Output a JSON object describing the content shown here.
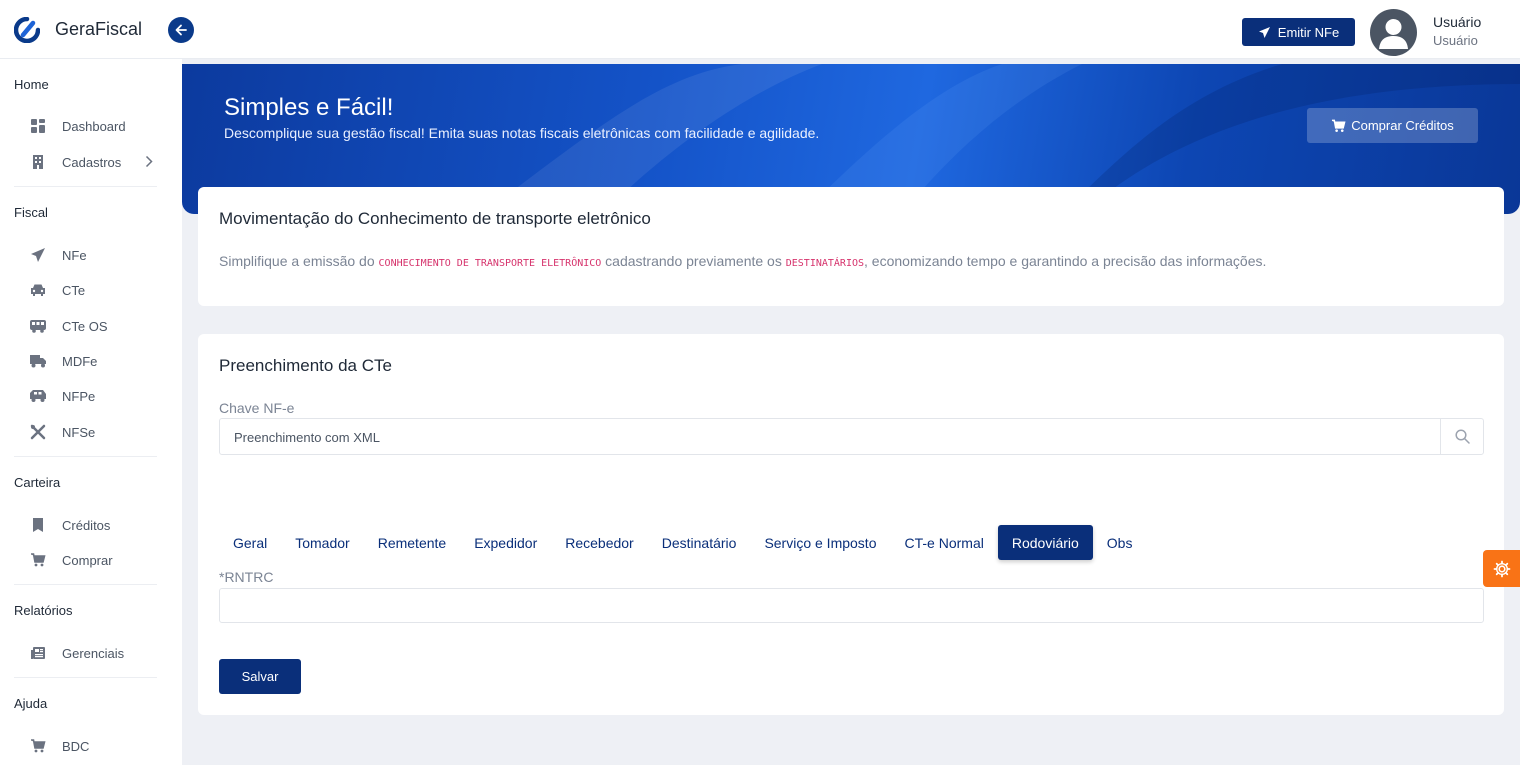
{
  "header": {
    "brand": "GeraFiscal",
    "emit_label": "Emitir NFe",
    "user_name": "Usuário",
    "user_role": "Usuário"
  },
  "sidebar": {
    "sections": [
      {
        "title": "Home",
        "items": [
          {
            "label": "Dashboard",
            "icon": "grid-icon"
          },
          {
            "label": "Cadastros",
            "icon": "building-icon"
          }
        ]
      },
      {
        "title": "Fiscal",
        "items": [
          {
            "label": "NFe",
            "icon": "paper-plane-icon"
          },
          {
            "label": "CTe",
            "icon": "car-icon"
          },
          {
            "label": "CTe OS",
            "icon": "bus-icon"
          },
          {
            "label": "MDFe",
            "icon": "truck-icon"
          },
          {
            "label": "NFPe",
            "icon": "van-icon"
          },
          {
            "label": "NFSe",
            "icon": "tools-icon"
          }
        ]
      },
      {
        "title": "Carteira",
        "items": [
          {
            "label": "Créditos",
            "icon": "bookmark-icon"
          },
          {
            "label": "Comprar",
            "icon": "cart-icon"
          }
        ]
      },
      {
        "title": "Relatórios",
        "items": [
          {
            "label": "Gerenciais",
            "icon": "newspaper-icon"
          }
        ]
      },
      {
        "title": "Ajuda",
        "items": [
          {
            "label": "BDC",
            "icon": "cart-icon"
          }
        ]
      }
    ]
  },
  "banner": {
    "title": "Simples e Fácil!",
    "subtitle": "Descomplique sua gestão fiscal! Emita suas notas fiscais eletrônicas com facilidade e agilidade.",
    "buy_label": "Comprar Créditos"
  },
  "intro": {
    "title": "Movimentação do Conhecimento de transporte eletrônico",
    "desc_part1": "Simplifique a emissão do ",
    "desc_code1": "CONHECIMENTO DE TRANSPORTE ELETRÔNICO",
    "desc_part2": " cadastrando previamente os ",
    "desc_code2": "DESTINATÁRIOS",
    "desc_part3": ", economizando tempo e garantindo a precisão das informações."
  },
  "form": {
    "title": "Preenchimento da CTe",
    "chave_label": "Chave NF-e",
    "chave_value": "Preenchimento com XML",
    "tabs": [
      "Geral",
      "Tomador",
      "Remetente",
      "Expedidor",
      "Recebedor",
      "Destinatário",
      "Serviço e Imposto",
      "CT-e Normal",
      "Rodoviário",
      "Obs"
    ],
    "active_tab": "Rodoviário",
    "rntrc_label": "*RNTRC",
    "rntrc_value": "",
    "save_label": "Salvar"
  },
  "colors": {
    "primary": "#0a2f7a",
    "accent": "#f97316",
    "code": "#d6336c"
  }
}
